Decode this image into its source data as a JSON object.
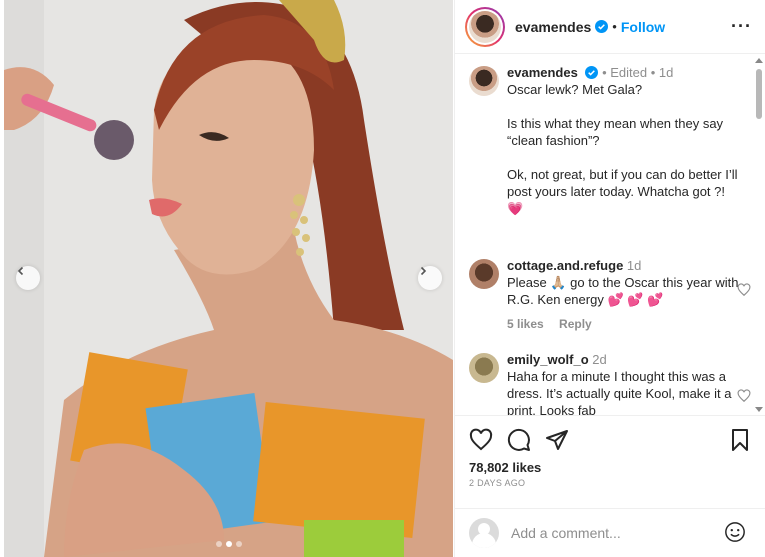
{
  "post": {
    "username": "evamendes",
    "follow_label": "Follow",
    "separator": "•",
    "more_label": "···"
  },
  "caption": {
    "username": "evamendes",
    "meta": "• Edited • 1d",
    "text": "Oscar lewk? Met Gala?\n\nIs this what they mean when they say “clean fashion”?\n\nOk, not great, but if you can do better I’ll post yours later today. Whatcha got ?! 💗"
  },
  "comments": [
    {
      "username": "cottage.and.refuge",
      "time": "1d",
      "text": "Please 🙏🏼 go to the Oscar this year with R.G. Ken energy 💕 💕 💕",
      "likes": "5 likes",
      "reply": "Reply"
    },
    {
      "username": "emily_wolf_o",
      "time": "2d",
      "text": "Haha for a minute I thought this was a dress. It’s actually quite Kool, make it a print. Looks fab",
      "likes": "",
      "reply": ""
    }
  ],
  "likes": "78,802 likes",
  "date": "2 DAYS AGO",
  "composer": {
    "placeholder": "Add a comment..."
  },
  "colors": {
    "link": "#0095f6",
    "heart_pink": "#e1306c",
    "sponge_orange": "#e8962a",
    "sponge_blue": "#5aa9d6",
    "sponge_green": "#9ccc3b"
  },
  "carousel": {
    "count": 3,
    "active_index": 2
  }
}
